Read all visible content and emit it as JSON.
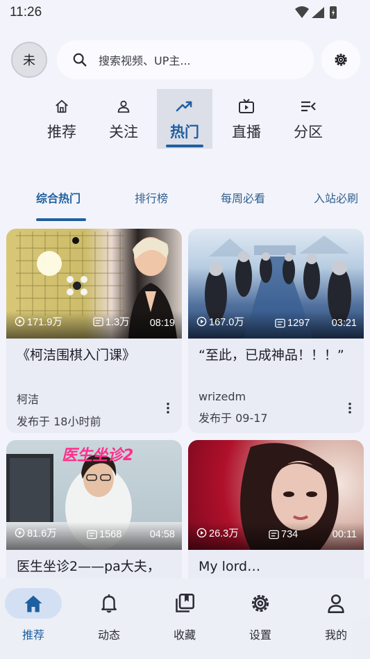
{
  "status_bar": {
    "time": "11:26"
  },
  "header": {
    "avatar_text": "未",
    "search_placeholder": "搜索视频、UP主..."
  },
  "top_tabs": [
    {
      "label": "推荐",
      "icon": "home-icon"
    },
    {
      "label": "关注",
      "icon": "person-icon"
    },
    {
      "label": "热门",
      "icon": "trending-icon",
      "active": true
    },
    {
      "label": "直播",
      "icon": "tv-icon"
    },
    {
      "label": "分区",
      "icon": "category-list-icon"
    }
  ],
  "sub_tabs": [
    {
      "label": "综合热门",
      "active": true
    },
    {
      "label": "排行榜"
    },
    {
      "label": "每周必看"
    },
    {
      "label": "入站必刷"
    }
  ],
  "videos": [
    {
      "views": "171.9万",
      "danmaku": "1.3万",
      "duration": "08:19",
      "title": "《柯洁围棋入门课》",
      "author": "柯洁",
      "published": "发布于 18小时前"
    },
    {
      "views": "167.0万",
      "danmaku": "1297",
      "duration": "03:21",
      "title": "“至此，已成神品！！！”",
      "author": "wrizedm",
      "published": "发布于 09-17"
    },
    {
      "views": "81.6万",
      "danmaku": "1568",
      "duration": "04:58",
      "title": "医生坐诊2——pa大夫，",
      "thumb_text": "医生坐诊2"
    },
    {
      "views": "26.3万",
      "danmaku": "734",
      "duration": "00:11",
      "title": "My lord…"
    }
  ],
  "bottom_nav": [
    {
      "label": "推荐",
      "icon": "home-icon",
      "active": true
    },
    {
      "label": "动态",
      "icon": "bell-icon"
    },
    {
      "label": "收藏",
      "icon": "collection-icon"
    },
    {
      "label": "设置",
      "icon": "gear-icon"
    },
    {
      "label": "我的",
      "icon": "person-icon"
    }
  ],
  "colors": {
    "accent": "#1f5fa0",
    "background": "#f3f4fb",
    "card": "#e9ebf5"
  }
}
